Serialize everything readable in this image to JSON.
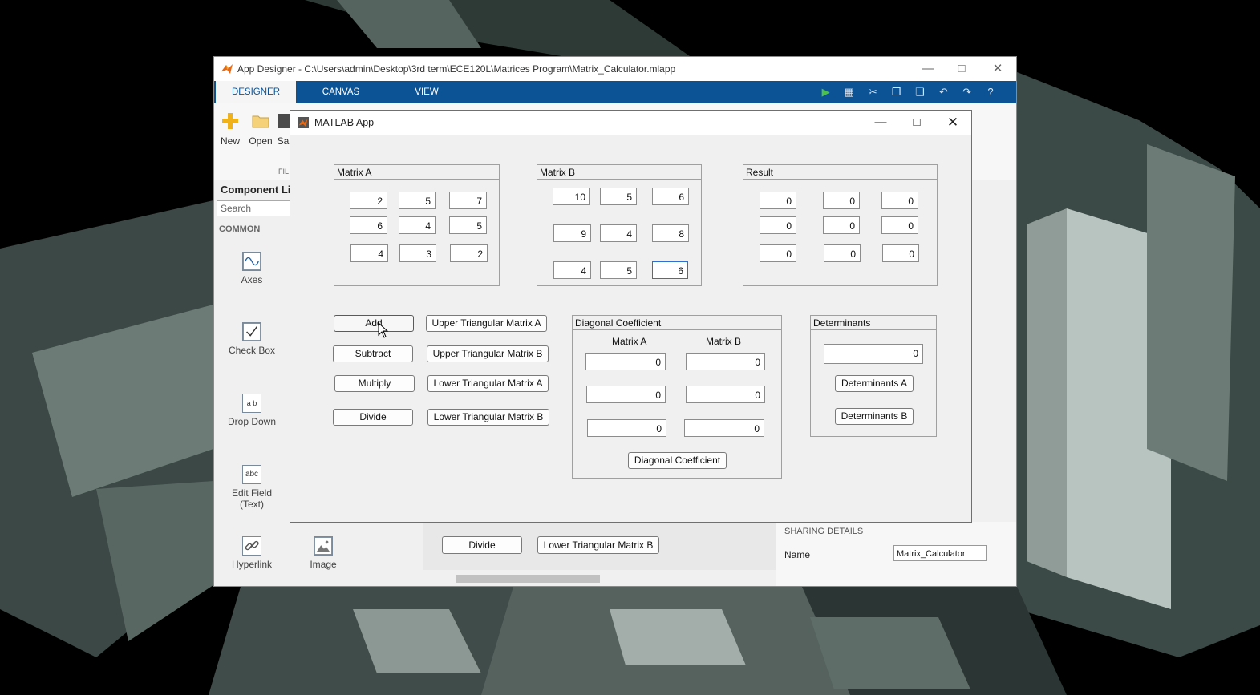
{
  "app_designer": {
    "title": "App Designer - C:\\Users\\admin\\Desktop\\3rd term\\ECE120L\\Matrices Program\\Matrix_Calculator.mlapp",
    "tabs": [
      "DESIGNER",
      "CANVAS",
      "VIEW"
    ],
    "ribbon": {
      "new_label": "New",
      "open_label": "Open",
      "save_label_partial": "Sa",
      "group_label_partial": "FIL"
    },
    "library": {
      "header": "Component Lib",
      "search_placeholder": "Search",
      "category": "COMMON",
      "items": [
        {
          "label": "Axes",
          "icon": "axes-icon"
        },
        {
          "label": "Check Box",
          "icon": "check-box-icon"
        },
        {
          "label": "Drop Down",
          "icon": "drop-down-icon",
          "glyph": "a b"
        },
        {
          "label_line1": "Edit Field",
          "label_line2": "(Text)",
          "icon": "edit-field-icon",
          "glyph": "abc"
        },
        {
          "label": "Hyperlink",
          "icon": "hyperlink-icon"
        },
        {
          "label": "Image",
          "icon": "image-icon"
        }
      ]
    },
    "canvas_behind": {
      "divide_label": "Divide",
      "lower_b_label": "Lower Triangular Matrix B"
    },
    "sharing": {
      "header": "SHARING DETAILS",
      "name_label": "Name",
      "name_value": "Matrix_Calculator"
    }
  },
  "matlab_app": {
    "title": "MATLAB App",
    "matrix_a": {
      "title": "Matrix A",
      "values": [
        "2",
        "5",
        "7",
        "6",
        "4",
        "5",
        "4",
        "3",
        "2"
      ]
    },
    "matrix_b": {
      "title": "Matrix B",
      "values": [
        "10",
        "5",
        "6",
        "9",
        "4",
        "8",
        "4",
        "5",
        "6"
      ]
    },
    "result": {
      "title": "Result",
      "values": [
        "0",
        "0",
        "0",
        "0",
        "0",
        "0",
        "0",
        "0",
        "0"
      ]
    },
    "ops": {
      "add": "Add",
      "subtract": "Subtract",
      "multiply": "Multiply",
      "divide": "Divide"
    },
    "triangular": {
      "upper_a": "Upper Triangular Matrix A",
      "upper_b": "Upper Triangular Matrix B",
      "lower_a": "Lower Triangular Matrix A",
      "lower_b": "Lower Triangular Matrix B"
    },
    "diagonal": {
      "title": "Diagonal Coefficient",
      "col_a": "Matrix A",
      "col_b": "Matrix B",
      "a_values": [
        "0",
        "0",
        "0"
      ],
      "b_values": [
        "0",
        "0",
        "0"
      ],
      "button": "Diagonal Coefficient"
    },
    "determinants": {
      "title": "Determinants",
      "value": "0",
      "button_a": "Determinants A",
      "button_b": "Determinants B"
    }
  },
  "colors": {
    "ribbon_blue": "#0b5394",
    "focus_blue": "#2f6fd0",
    "window_gray": "#f0f0f0"
  }
}
